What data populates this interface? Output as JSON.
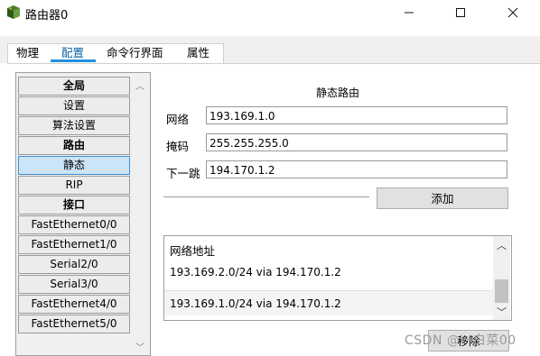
{
  "window": {
    "title": "路由器0",
    "min_glyph": "—",
    "max_glyph": "☐",
    "close_glyph": "✕",
    "icon": "router-icon"
  },
  "tabs": [
    {
      "label": "物理"
    },
    {
      "label": "配置",
      "active": true
    },
    {
      "label": "命令行界面"
    },
    {
      "label": "属性"
    }
  ],
  "sidebar": {
    "items": [
      {
        "label": "全局",
        "type": "header"
      },
      {
        "label": "设置"
      },
      {
        "label": "算法设置"
      },
      {
        "label": "路由",
        "type": "header"
      },
      {
        "label": "静态",
        "selected": true
      },
      {
        "label": "RIP"
      },
      {
        "label": "接口",
        "type": "header"
      },
      {
        "label": "FastEthernet0/0"
      },
      {
        "label": "FastEthernet1/0"
      },
      {
        "label": "Serial2/0"
      },
      {
        "label": "Serial3/0"
      },
      {
        "label": "FastEthernet4/0"
      },
      {
        "label": "FastEthernet5/0"
      }
    ],
    "scroll_up_glyph": "︿",
    "scroll_down_glyph": "﹀"
  },
  "static_route": {
    "title": "静态路由",
    "network_label": "网络",
    "network_value": "193.169.1.0",
    "mask_label": "掩码",
    "mask_value": "255.255.255.0",
    "nexthop_label": "下一跳",
    "nexthop_value": "194.170.1.2",
    "add_button": "添加",
    "list_header": "网络地址",
    "routes": [
      "193.169.2.0/24 via 194.170.1.2",
      "193.169.1.0/24 via 194.170.1.2"
    ],
    "remove_button": "移除",
    "scroll_up_glyph": "︿",
    "scroll_down_glyph": "﹀"
  },
  "watermark": "CSDN @一白菜00",
  "colors": {
    "accent": "#1f8fe0",
    "selected_bg": "#cce4f7"
  }
}
